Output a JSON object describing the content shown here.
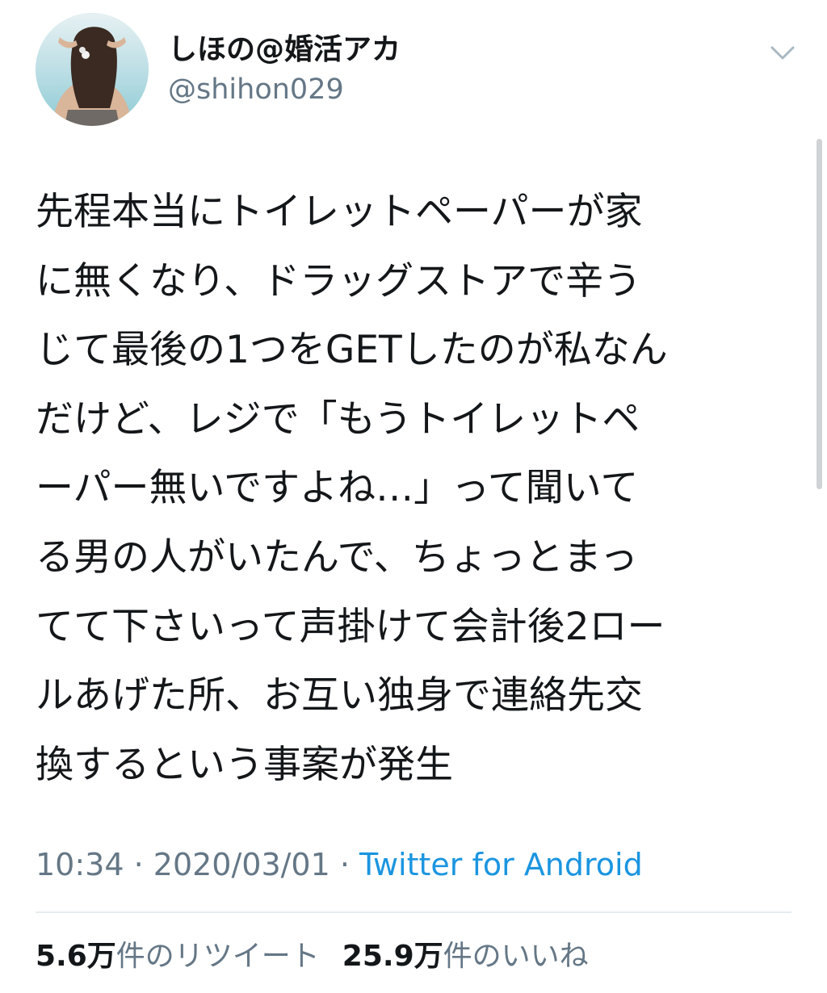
{
  "profile": {
    "display_name": "しほの@婚活アカ",
    "handle": "@shihon029",
    "avatar_icon": "profile-photo",
    "menu_icon": "chevron-down-icon"
  },
  "tweet": {
    "lines": [
      "先程本当にトイレットペーパーが家",
      "に無くなり、ドラッグストアで辛う",
      "じて最後の1つをGETしたのが私なん",
      "だけど、レジで「もうトイレットペ",
      "ーパー無いですよね…」って聞いて",
      "る男の人がいたんで、ちょっとまっ",
      "てて下さいって声掛けて会計後2ロー",
      "ルあげた所、お互い独身で連絡先交",
      "換するという事案が発生"
    ],
    "time": "10:34",
    "separator": " · ",
    "date": "2020/03/01",
    "source": "Twitter for Android"
  },
  "stats": {
    "retweets_count": "5.6万",
    "retweets_label": "件のリツイート",
    "likes_count": "25.9万",
    "likes_label": "件のいいね"
  },
  "colors": {
    "text": "#14171a",
    "secondary": "#657786",
    "link": "#1b95e0",
    "divider": "#e6ecf0"
  }
}
